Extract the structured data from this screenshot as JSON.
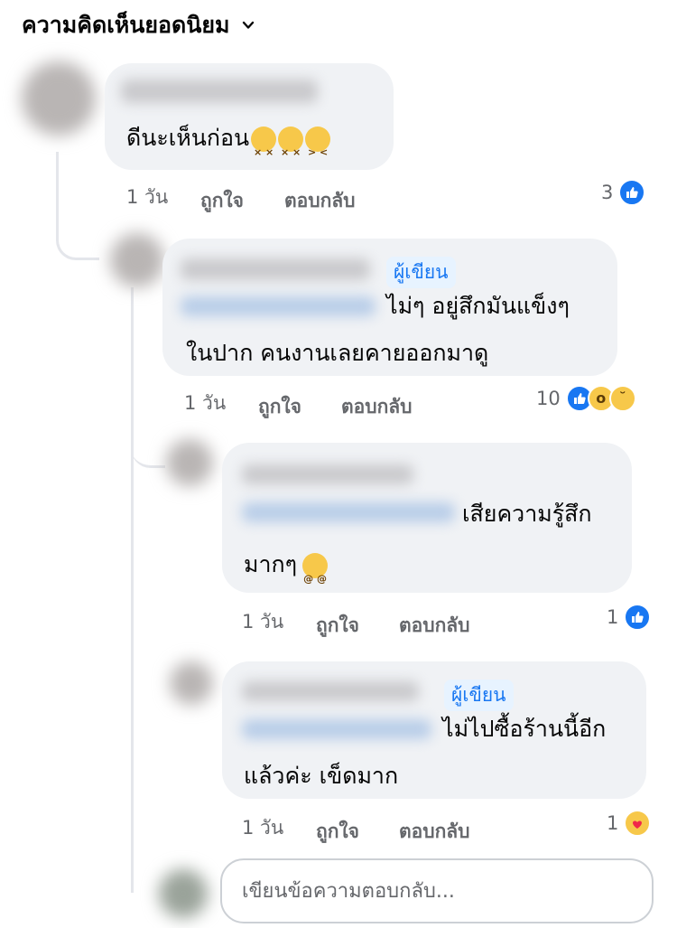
{
  "header": {
    "title": "ความคิดเห็นยอดนิยม"
  },
  "comments": [
    {
      "text": "ดีนะเห็นก่อน",
      "time": "1 วัน",
      "like_label": "ถูกใจ",
      "reply_label": "ตอบกลับ",
      "reaction_count": "3",
      "reaction_icons": [
        "like-icon"
      ]
    },
    {
      "author_badge": "ผู้เขียน",
      "text_line1": "ไม่ๆ อยู่สึกมันแข็งๆ",
      "text_line2": "ในปาก คนงานเลยคายออกมาดู",
      "time": "1 วัน",
      "like_label": "ถูกใจ",
      "reply_label": "ตอบกลับ",
      "reaction_count": "10",
      "reaction_icons": [
        "like-icon",
        "wow-icon",
        "sad-icon"
      ]
    },
    {
      "text_line1": "เสียความรู้สึก",
      "text_line2": "มากๆ",
      "time": "1 วัน",
      "like_label": "ถูกใจ",
      "reply_label": "ตอบกลับ",
      "reaction_count": "1",
      "reaction_icons": [
        "like-icon"
      ]
    },
    {
      "author_badge": "ผู้เขียน",
      "text_line1": "ไม่ไปซื้อร้านนี้อีก",
      "text_line2": "แล้วค่ะ เข็ดมาก",
      "time": "1 วัน",
      "like_label": "ถูกใจ",
      "reply_label": "ตอบกลับ",
      "reaction_count": "1",
      "reaction_icons": [
        "care-icon"
      ]
    }
  ],
  "reply_box": {
    "placeholder": "เขียนข้อความตอบกลับ..."
  },
  "colors": {
    "accent": "#1877f2",
    "bubble": "#f0f2f5",
    "muted": "#65676b",
    "emoji": "#f7c84a"
  }
}
